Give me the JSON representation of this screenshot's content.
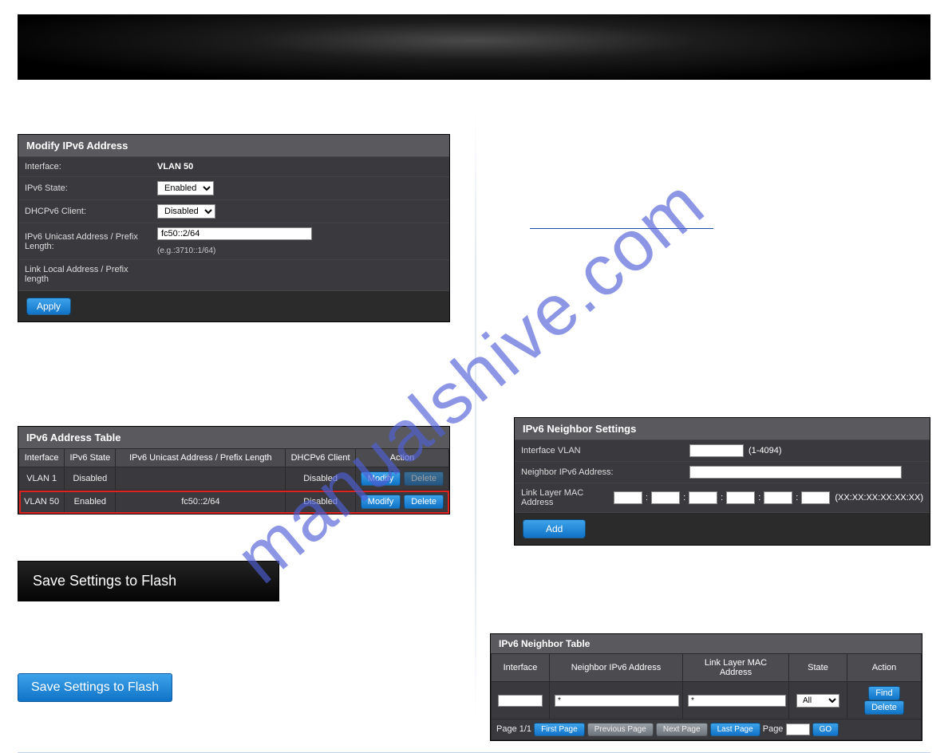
{
  "watermark": "manualshive.com",
  "modify_ipv6": {
    "title": "Modify IPv6 Address",
    "rows": {
      "interface_label": "Interface:",
      "interface_value": "VLAN 50",
      "state_label": "IPv6 State:",
      "state_value": "Enabled",
      "dhcp_label": "DHCPv6 Client:",
      "dhcp_value": "Disabled",
      "unicast_label": "IPv6 Unicast Address / Prefix Length:",
      "unicast_value": "fc50::2/64",
      "unicast_hint": "(e.g.:3710::1/64)",
      "linklocal_label": "Link Local Address / Prefix length"
    },
    "apply": "Apply"
  },
  "addr_table": {
    "title": "IPv6 Address Table",
    "headers": [
      "Interface",
      "IPv6 State",
      "IPv6 Unicast Address / Prefix Length",
      "DHCPv6 Client",
      "Action"
    ],
    "actions": {
      "modify": "Modify",
      "delete": "Delete"
    },
    "rows": [
      {
        "iface": "VLAN 1",
        "state": "Disabled",
        "unicast": "",
        "dhcp": "Disabled",
        "delete_disabled": true,
        "highlight": false
      },
      {
        "iface": "VLAN 50",
        "state": "Enabled",
        "unicast": "fc50::2/64",
        "dhcp": "Disabled",
        "delete_disabled": false,
        "highlight": true
      }
    ]
  },
  "sstf_dark": "Save Settings to Flash",
  "sstf_btn": "Save Settings to Flash",
  "right_breadcrumb": {
    "text": "",
    "link": ""
  },
  "neighbor_settings": {
    "title": "IPv6 Neighbor Settings",
    "iface_label": "Interface VLAN",
    "iface_hint": "(1-4094)",
    "addr_label": "Neighbor IPv6 Address:",
    "mac_label": "Link Layer MAC Address",
    "mac_hint": "(XX:XX:XX:XX:XX:XX)",
    "add": "Add"
  },
  "neighbor_table": {
    "title": "IPv6 Neighbor Table",
    "headers": [
      "Interface",
      "Neighbor IPv6 Address",
      "Link Layer MAC Address",
      "State",
      "Action"
    ],
    "filters": {
      "iface": "",
      "addr": "*",
      "mac": "*",
      "state": "All"
    },
    "actions": {
      "find": "Find",
      "delete": "Delete"
    },
    "pager": {
      "status": "Page 1/1",
      "first": "First Page",
      "prev": "Previous Page",
      "next": "Next Page",
      "last": "Last Page",
      "page_label": "Page",
      "page_value": "",
      "go": "GO"
    }
  }
}
